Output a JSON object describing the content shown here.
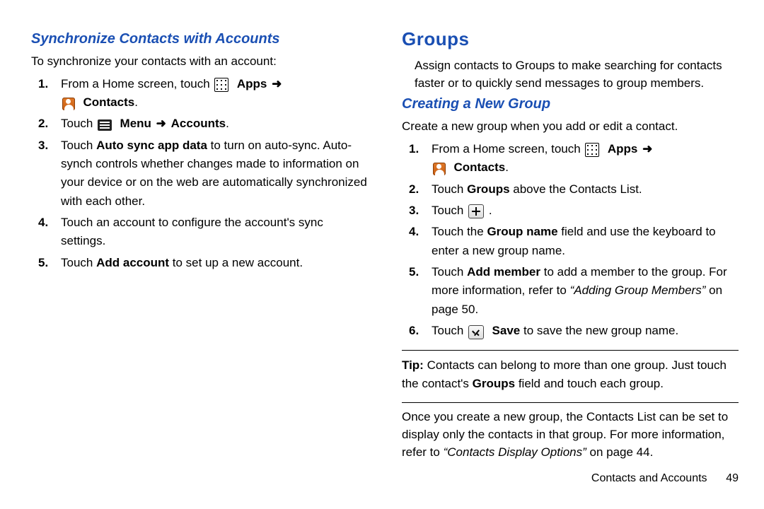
{
  "left": {
    "heading": "Synchronize Contacts with Accounts",
    "intro": "To synchronize your contacts with an account:",
    "steps": {
      "s1_a": "From a Home screen, touch ",
      "s1_apps": "Apps",
      "s1_contacts": "Contacts",
      "s1_period": ".",
      "s2_a": "Touch ",
      "s2_menu": "Menu",
      "s2_accounts": "Accounts",
      "s2_period": ".",
      "s3_a": "Touch ",
      "s3_bold": "Auto sync app data",
      "s3_b": " to turn on auto-sync. Auto-synch controls whether changes made to information on your device or on the web are automatically synchronized with each other.",
      "s4": "Touch an account to configure the account's sync settings.",
      "s5_a": "Touch ",
      "s5_bold": "Add account",
      "s5_b": " to set up a new account."
    }
  },
  "right": {
    "major": "Groups",
    "intro": "Assign contacts to Groups to make searching for contacts faster or to quickly send messages to group members.",
    "sub": "Creating a New Group",
    "subintro": "Create a new group when you add or edit a contact.",
    "steps": {
      "s1_a": "From a Home screen, touch ",
      "s1_apps": "Apps",
      "s1_contacts": "Contacts",
      "s1_period": ".",
      "s2_a": "Touch ",
      "s2_bold": "Groups",
      "s2_b": " above the Contacts List.",
      "s3_a": "Touch ",
      "s3_period": " .",
      "s4_a": "Touch the ",
      "s4_bold": "Group name",
      "s4_b": " field and use the keyboard to enter a new group name.",
      "s5_a": "Touch ",
      "s5_bold": "Add member",
      "s5_b": " to add a member to the group. For more information, refer to ",
      "s5_ref": "“Adding Group Members”",
      "s5_c": " on page 50.",
      "s6_a": "Touch ",
      "s6_bold": "Save",
      "s6_b": " to save the new group name."
    },
    "tip_label": "Tip:",
    "tip_a": " Contacts can belong to more than one group. Just touch the contact's ",
    "tip_bold": "Groups",
    "tip_b": " field and touch each group.",
    "after_a": "Once you create a new group, the Contacts List can be set to display only the contacts in that group. For more information, refer to ",
    "after_ref": "“Contacts Display Options”",
    "after_b": "  on page 44."
  },
  "arrow": "➜",
  "footer": {
    "section": "Contacts and Accounts",
    "page": "49"
  }
}
